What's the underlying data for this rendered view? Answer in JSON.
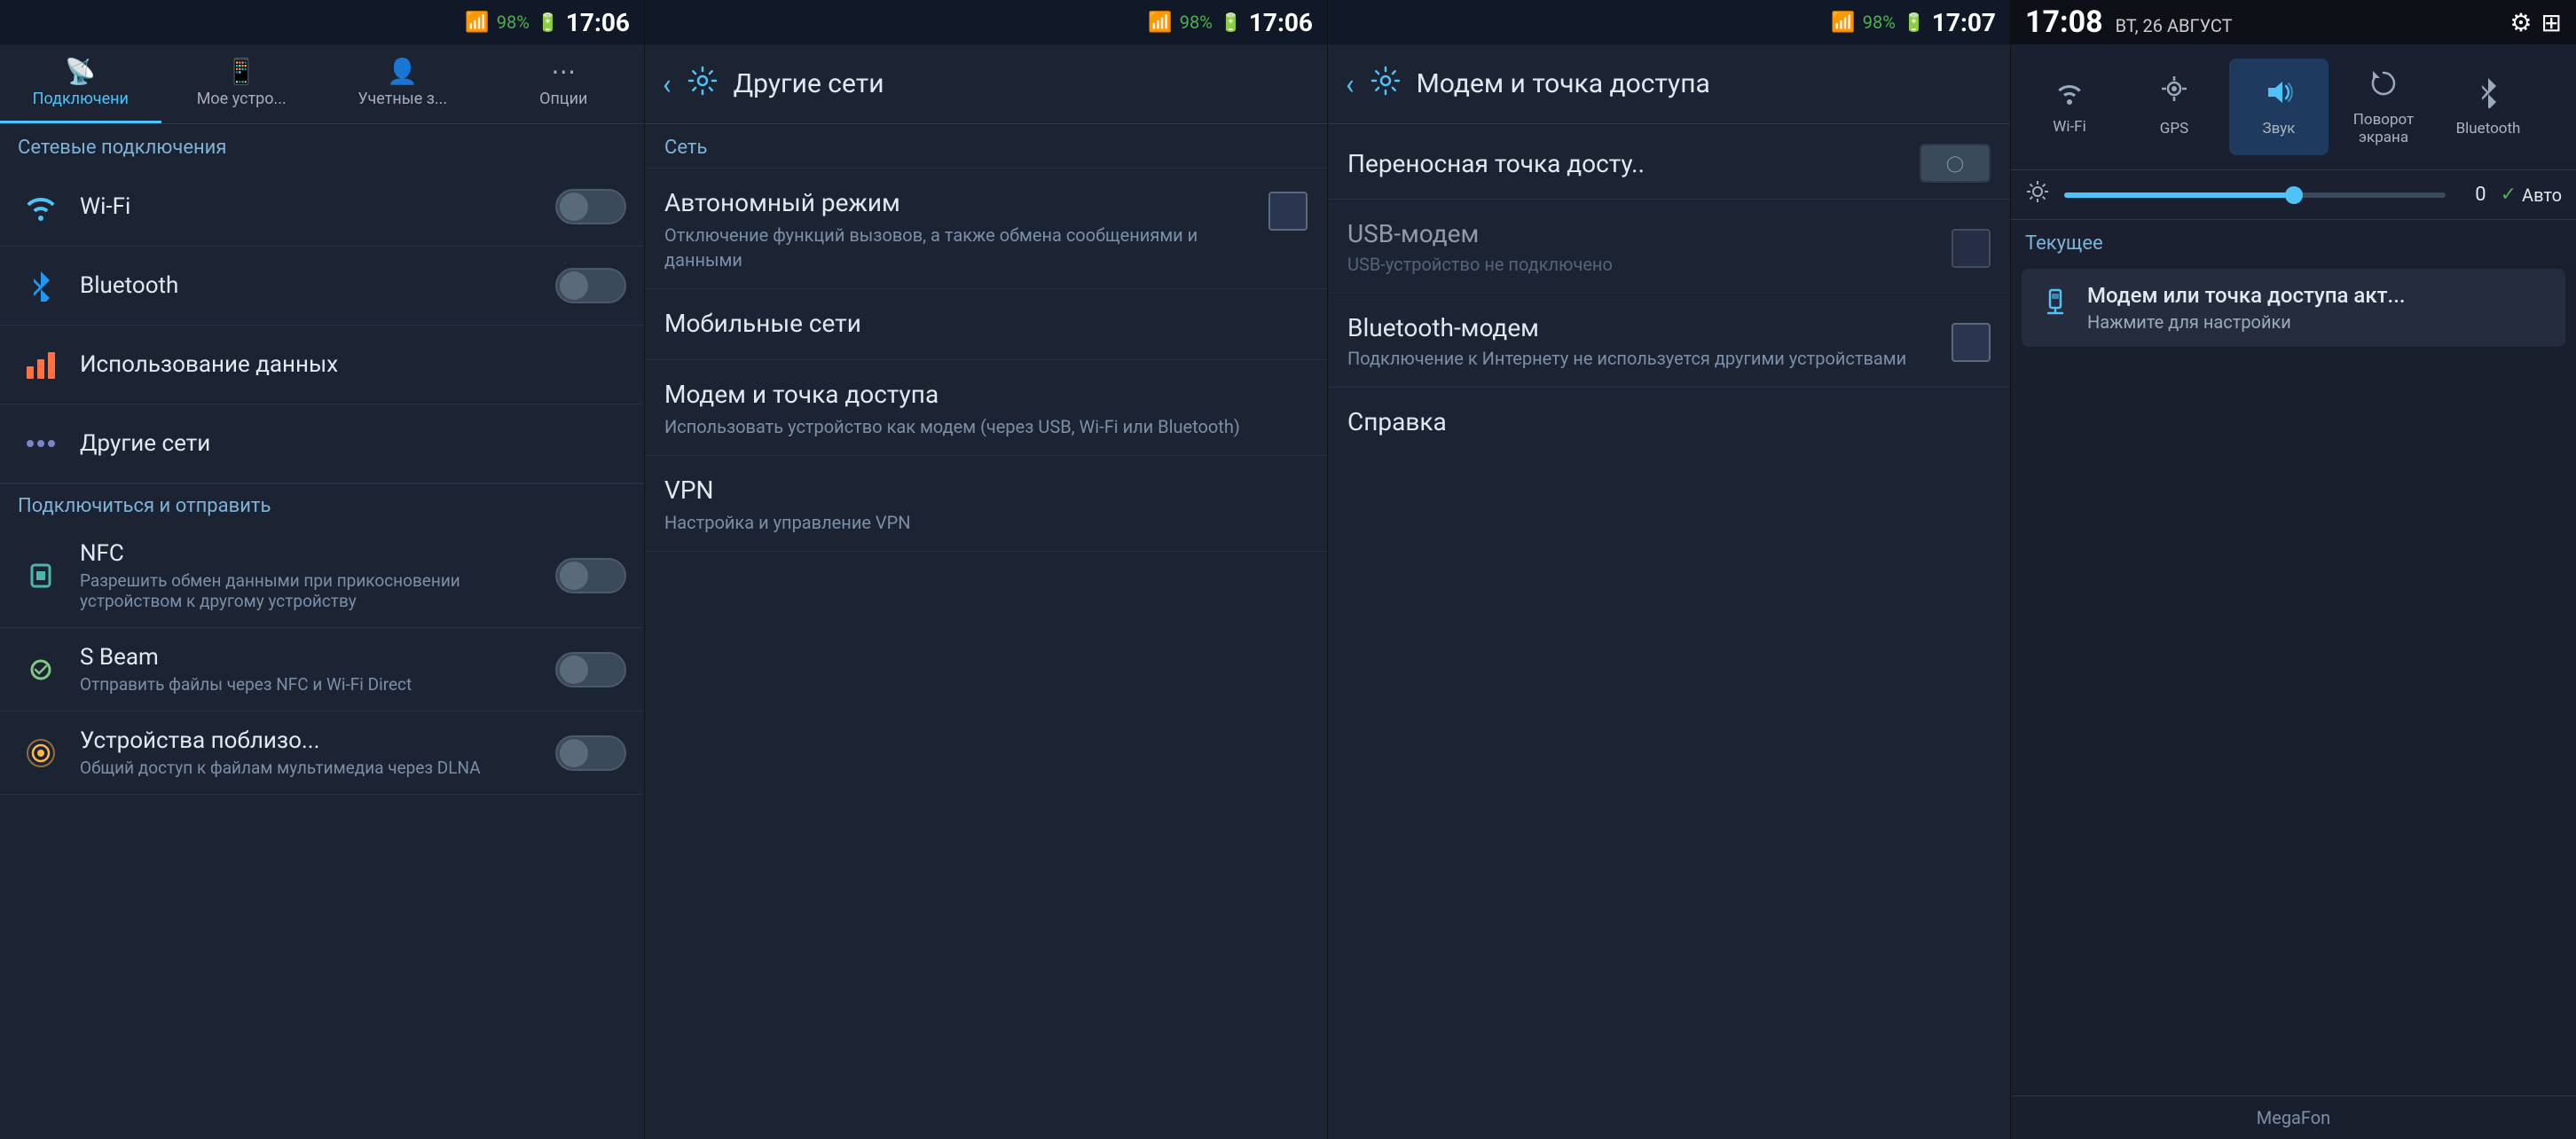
{
  "panel1": {
    "status_bar": {
      "signal": "📶",
      "battery_pct": "98%",
      "time": "17:06",
      "battery_icon": "🔋"
    },
    "tabs": [
      {
        "id": "connections",
        "label": "Подключени",
        "icon": "📡",
        "active": true
      },
      {
        "id": "my-device",
        "label": "Мое устро...",
        "icon": "📱",
        "active": false
      },
      {
        "id": "accounts",
        "label": "Учетные з...",
        "icon": "👤",
        "active": false
      },
      {
        "id": "options",
        "label": "Опции",
        "icon": "⋯",
        "active": false
      }
    ],
    "section_network": "Сетевые подключения",
    "items_network": [
      {
        "id": "wifi",
        "icon": "wifi",
        "title": "Wi-Fi",
        "toggle": true,
        "toggle_on": false
      },
      {
        "id": "bluetooth",
        "icon": "bluetooth",
        "title": "Bluetooth",
        "toggle": true,
        "toggle_on": false
      },
      {
        "id": "data-usage",
        "icon": "data",
        "title": "Использование данных",
        "toggle": false
      },
      {
        "id": "other-networks",
        "icon": "other",
        "title": "Другие сети",
        "toggle": false
      }
    ],
    "section_share": "Подключиться и отправить",
    "items_share": [
      {
        "id": "nfc",
        "icon": "nfc",
        "title": "NFC",
        "subtitle": "Разрешить обмен данными при прикосновении устройством к другому устройству",
        "toggle": true,
        "toggle_on": false
      },
      {
        "id": "sbeam",
        "icon": "sbeam",
        "title": "S Beam",
        "subtitle": "Отправить файлы через NFC и Wi-Fi Direct",
        "toggle": true,
        "toggle_on": false
      },
      {
        "id": "nearby",
        "icon": "nearby",
        "title": "Устройства поблизо...",
        "subtitle": "Общий доступ к файлам мультимедиа через DLNA",
        "toggle": true,
        "toggle_on": false
      }
    ]
  },
  "panel2": {
    "status_bar": {
      "battery_pct": "98%",
      "time": "17:06"
    },
    "header": {
      "back_icon": "‹",
      "settings_icon": "⚙",
      "title": "Другие сети"
    },
    "section_net": "Сеть",
    "items": [
      {
        "id": "airplane",
        "title": "Автономный режим",
        "subtitle": "Отключение функций вызовов, а также обмена сообщениями и данными",
        "has_checkbox": true
      },
      {
        "id": "mobile-net",
        "title": "Мобильные сети",
        "subtitle": ""
      },
      {
        "id": "tethering",
        "title": "Модем и точка доступа",
        "subtitle": "Использовать устройство как модем (через USB, Wi-Fi или Bluetooth)"
      },
      {
        "id": "vpn",
        "title": "VPN",
        "subtitle": "Настройка и управление VPN"
      }
    ]
  },
  "panel3": {
    "status_bar": {
      "battery_pct": "98%",
      "time": "17:07"
    },
    "header": {
      "back_icon": "‹",
      "settings_icon": "⚙",
      "title": "Модем и точка доступа"
    },
    "items": [
      {
        "id": "wifi-hotspot",
        "title": "Переносная точка досту..",
        "subtitle": "",
        "has_toggle": true,
        "toggle_on": false
      },
      {
        "id": "usb-tether",
        "title": "USB-модем",
        "subtitle": "USB-устройство не подключено",
        "has_checkbox": true,
        "disabled": true
      },
      {
        "id": "bt-tether",
        "title": "Bluetooth-модем",
        "subtitle": "Подключение к Интернету не используется другими устройствами",
        "has_checkbox": true,
        "disabled": false
      }
    ],
    "help": {
      "title": "Справка"
    }
  },
  "panel4": {
    "time": "17:08",
    "date": "ВТ, 26 АВГУСТ",
    "settings_icon": "⚙",
    "grid_icon": "⊞",
    "quick_toggles": [
      {
        "id": "wifi",
        "icon": "wifi",
        "label": "Wi-Fi",
        "active": false
      },
      {
        "id": "gps",
        "icon": "gps",
        "label": "GPS",
        "active": false
      },
      {
        "id": "sound",
        "icon": "sound",
        "label": "Звук",
        "active": true
      },
      {
        "id": "rotate",
        "icon": "rotate",
        "label": "Поворот\nэкрана",
        "active": false
      },
      {
        "id": "bluetooth",
        "icon": "bt",
        "label": "Bluetooth",
        "active": false
      }
    ],
    "brightness": {
      "value": "0",
      "auto_label": "Авто",
      "auto_checked": true
    },
    "section_current": "Текущее",
    "notification": {
      "icon": "usb",
      "title": "Модем или точка доступа акт...",
      "subtitle": "Нажмите для настройки"
    },
    "carrier": "MegaFon"
  }
}
